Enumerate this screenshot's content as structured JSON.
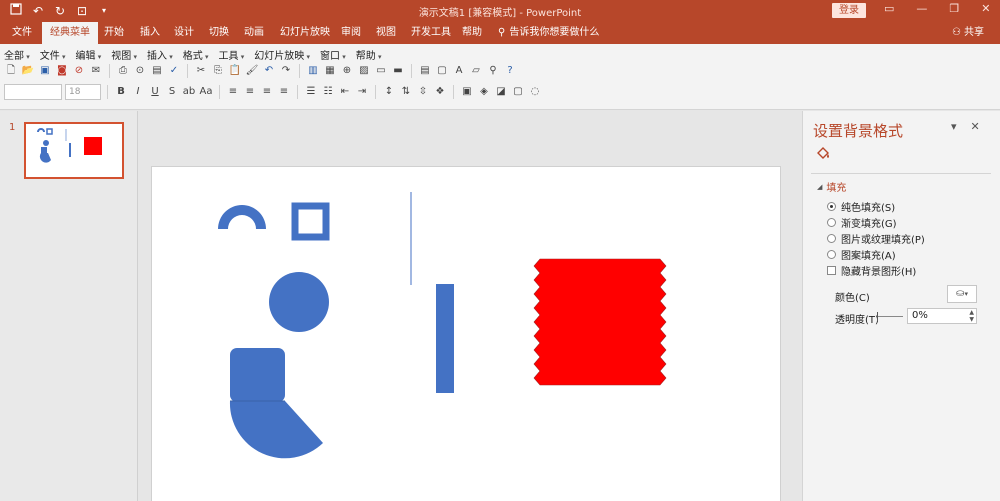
{
  "app": {
    "title": "演示文稿1 [兼容模式] - PowerPoint",
    "login_label": "登录",
    "share_label": "共享"
  },
  "tabs": [
    {
      "label": "文件"
    },
    {
      "label": "经典菜单"
    },
    {
      "label": "开始"
    },
    {
      "label": "插入"
    },
    {
      "label": "设计"
    },
    {
      "label": "切换"
    },
    {
      "label": "动画"
    },
    {
      "label": "幻灯片放映"
    },
    {
      "label": "审阅"
    },
    {
      "label": "视图"
    },
    {
      "label": "开发工具"
    },
    {
      "label": "帮助"
    }
  ],
  "tell_me": "告诉我你想要做什么",
  "menubar": [
    "全部",
    "文件",
    "编辑",
    "视图",
    "插入",
    "格式",
    "工具",
    "幻灯片放映",
    "窗口",
    "帮助"
  ],
  "font": {
    "size_placeholder": "18"
  },
  "thumbnails": [
    {
      "number": "1"
    }
  ],
  "format_pane": {
    "title": "设置背景格式",
    "section": "填充",
    "options": [
      {
        "label": "纯色填充(S)",
        "type": "radio",
        "checked": true
      },
      {
        "label": "渐变填充(G)",
        "type": "radio",
        "checked": false
      },
      {
        "label": "图片或纹理填充(P)",
        "type": "radio",
        "checked": false
      },
      {
        "label": "图案填充(A)",
        "type": "radio",
        "checked": false
      },
      {
        "label": "隐藏背景图形(H)",
        "type": "checkbox",
        "checked": false
      }
    ],
    "color_label": "颜色(C)",
    "transparency_label": "透明度(T)",
    "transparency_value": "0%"
  },
  "colors": {
    "accent": "#b7472a",
    "shape_blue": "#4472c4",
    "shape_red": "#ff0000"
  }
}
